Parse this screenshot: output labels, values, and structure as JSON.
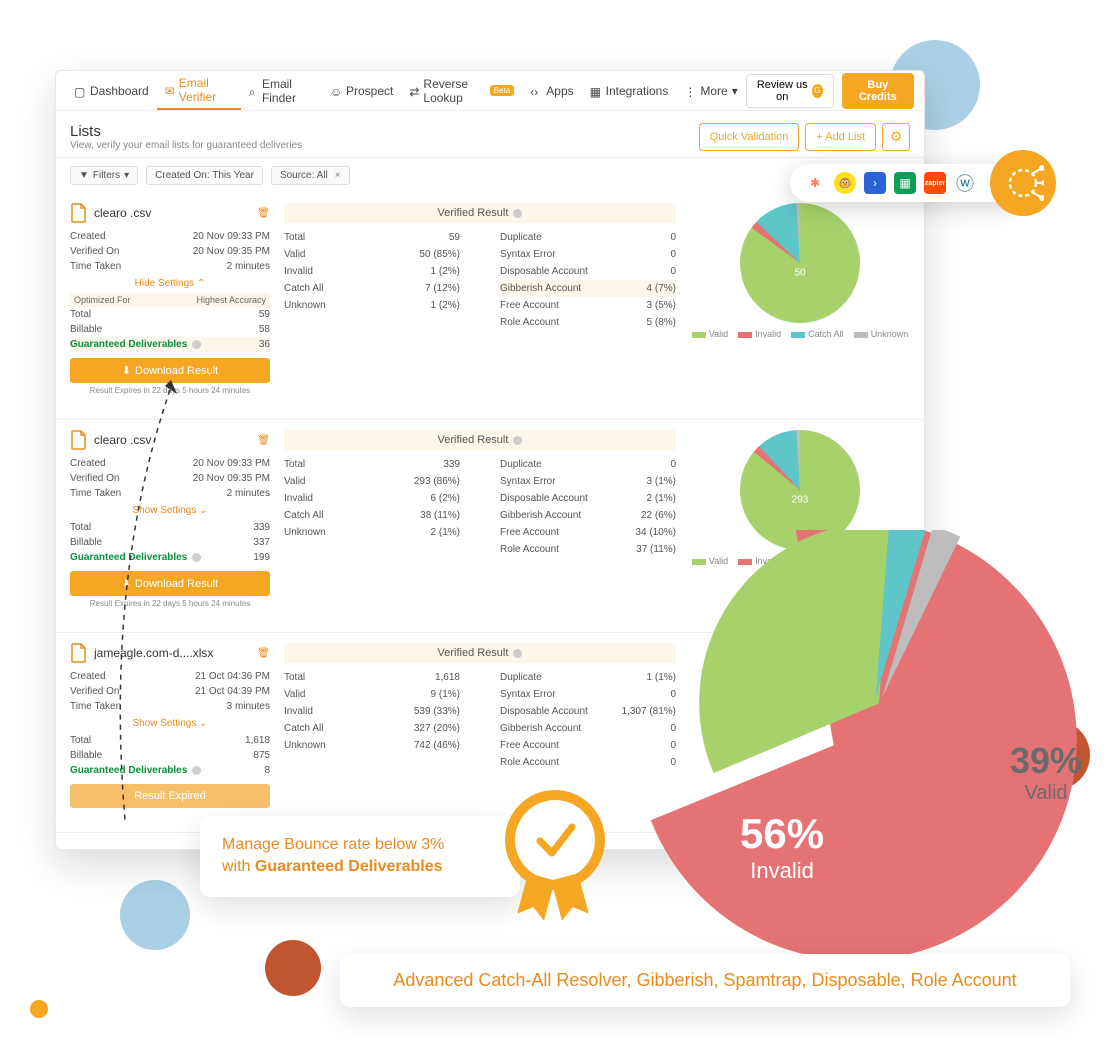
{
  "nav": {
    "items": [
      {
        "label": "Dashboard",
        "icon": "dashboard"
      },
      {
        "label": "Email Verifier",
        "icon": "mail",
        "active": true
      },
      {
        "label": "Email Finder",
        "icon": "search"
      },
      {
        "label": "Prospect",
        "icon": "user"
      },
      {
        "label": "Reverse Lookup",
        "icon": "swap",
        "badge": "Beta"
      },
      {
        "label": "Apps",
        "icon": "code"
      },
      {
        "label": "Integrations",
        "icon": "grid"
      },
      {
        "label": "More",
        "icon": "dots"
      }
    ],
    "review_label": "Review us on",
    "buy_label": "Buy Credits"
  },
  "page": {
    "title": "Lists",
    "subtitle": "View, verify your email lists for guaranteed deliveries",
    "quick_validation": "Quick Validation",
    "add_list": "+ Add List"
  },
  "filters": {
    "filters_label": "Filters",
    "created_on": "Created On: This Year",
    "source": "Source: All"
  },
  "legend": {
    "valid": "Valid",
    "invalid": "Invalid",
    "catch_all": "Catch All",
    "unknown": "Unknown"
  },
  "common": {
    "verified_result": "Verified Result",
    "created": "Created",
    "verified_on": "Verified On",
    "time_taken": "Time Taken",
    "hide_settings": "Hide Settings",
    "show_settings": "Show Settings",
    "optimized_for": "Optimized For",
    "highest_accuracy": "Highest Accuracy",
    "total": "Total",
    "billable": "Billable",
    "guaranteed": "Guaranteed Deliverables",
    "download": "Download Result",
    "result_expired": "Result Expired",
    "expiry": "Result Expires in 22 days 5 hours 24 minutes",
    "valid": "Valid",
    "invalid": "Invalid",
    "catch_all": "Catch All",
    "unknown": "Unknown",
    "duplicate": "Duplicate",
    "syntax_error": "Syntax Error",
    "disposable": "Disposable Account",
    "gibberish": "Gibberish Account",
    "free": "Free Account",
    "role": "Role Account"
  },
  "lists": [
    {
      "filename": "clearo            .csv",
      "created": "20 Nov 09:33 PM",
      "verified_on": "20 Nov 09:35 PM",
      "time_taken": "2 minutes",
      "total": "59",
      "billable": "58",
      "guaranteed": "36",
      "show_settings": false,
      "highlight_guaranteed": true,
      "stats": {
        "total": "59",
        "valid": "50 (85%)",
        "invalid": "1 (2%)",
        "catch_all": "7 (12%)",
        "unknown": "1 (2%)",
        "duplicate": "0",
        "syntax_error": "0",
        "disposable": "0",
        "gibberish": "4 (7%)",
        "free": "3 (5%)",
        "role": "5 (8%)"
      },
      "pie": {
        "valid": 85,
        "invalid": 2,
        "catch_all": 12,
        "unknown": 1,
        "center": "50"
      },
      "highlight_gibberish": true
    },
    {
      "filename": "clearo            .csv",
      "created": "20 Nov 09:33 PM",
      "verified_on": "20 Nov 09:35 PM",
      "time_taken": "2 minutes",
      "total": "339",
      "billable": "337",
      "guaranteed": "199",
      "show_settings": true,
      "stats": {
        "total": "339",
        "valid": "293 (86%)",
        "invalid": "6 (2%)",
        "catch_all": "38 (11%)",
        "unknown": "2 (1%)",
        "duplicate": "0",
        "syntax_error": "3 (1%)",
        "disposable": "2 (1%)",
        "gibberish": "22 (6%)",
        "free": "34 (10%)",
        "role": "37 (11%)"
      },
      "pie": {
        "valid": 86,
        "invalid": 2,
        "catch_all": 11,
        "unknown": 1,
        "center": "293"
      }
    },
    {
      "filename": "jameagle.com-d....xlsx",
      "created": "21 Oct 04:36 PM",
      "verified_on": "21 Oct 04:39 PM",
      "time_taken": "3 minutes",
      "total": "1,618",
      "billable": "875",
      "guaranteed": "8",
      "show_settings": true,
      "expired": true,
      "stats": {
        "total": "1,618",
        "valid": "9 (1%)",
        "invalid": "539 (33%)",
        "catch_all": "327 (20%)",
        "unknown": "742 (46%)",
        "duplicate": "1 (1%)",
        "syntax_error": "0",
        "disposable": "1,307 (81%)",
        "gibberish": "0",
        "free": "0",
        "role": "0"
      }
    }
  ],
  "integrations": {
    "icons": [
      "hubspot",
      "mailchimp",
      "activecampaign",
      "sheets",
      "zapier",
      "wordpress",
      "more"
    ]
  },
  "callouts": {
    "bounce_line1": "Manage Bounce rate below 3%",
    "bounce_line2_prefix": "with ",
    "bounce_line2_bold": "Guaranteed Deliverables",
    "bottom_banner": "Advanced Catch-All Resolver, Gibberish, Spamtrap, Disposable, Role Account"
  },
  "big_pie": {
    "invalid_pct": "56%",
    "invalid_label": "Invalid",
    "valid_pct": "39%",
    "valid_label": "Valid",
    "slices": {
      "invalid": 56,
      "valid": 39,
      "catch_all": 3,
      "unknown": 2
    }
  },
  "colors": {
    "valid": "#a7d26b",
    "invalid": "#e57373",
    "catch_all": "#5ec5c8",
    "unknown": "#bdbdbd",
    "accent": "#f5a623",
    "accent_text": "#e88b1e"
  }
}
